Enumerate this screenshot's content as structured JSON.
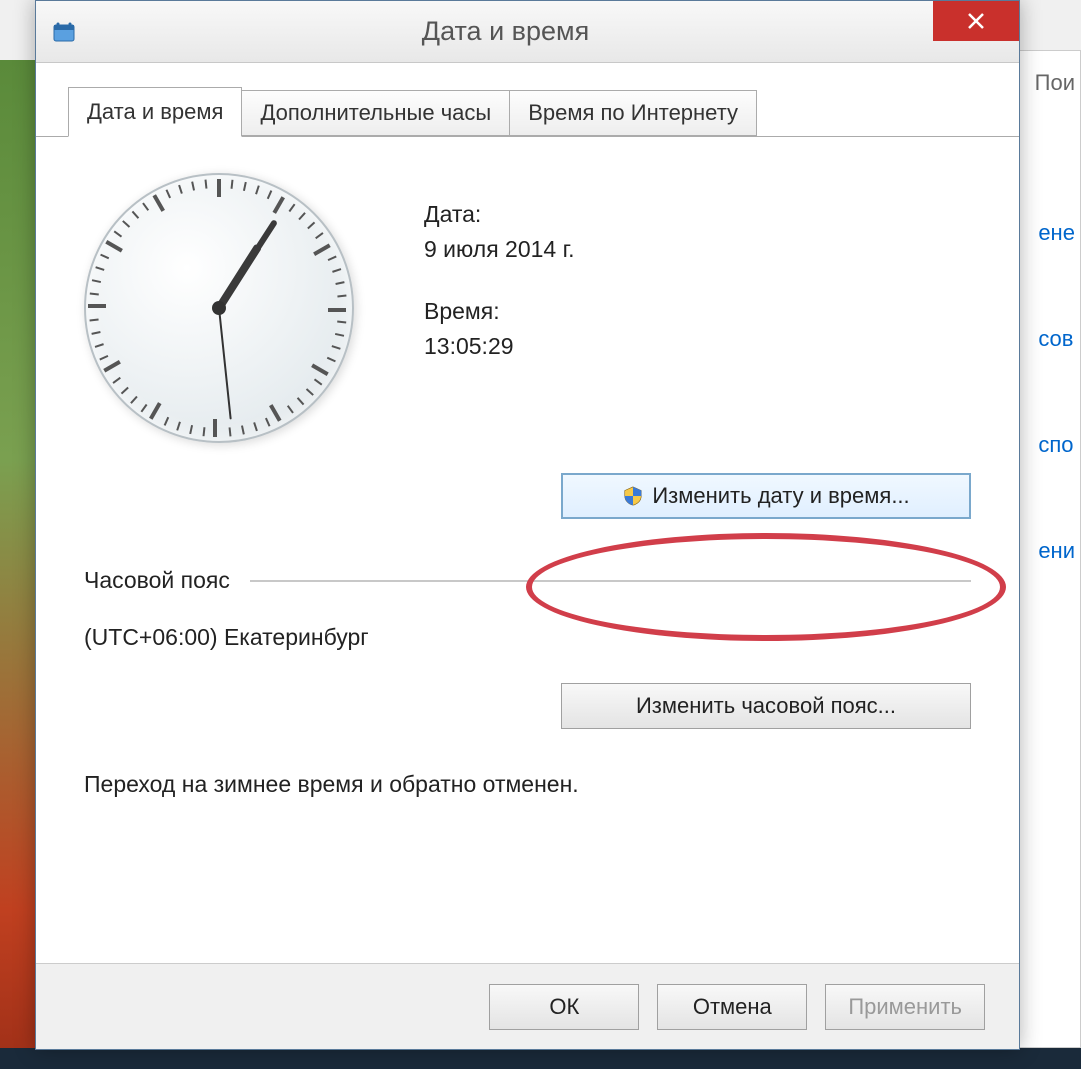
{
  "background": {
    "search_fragment": "Пои",
    "link1_fragment": "ене",
    "link2_fragment": "сов",
    "link3_fragment": "спо",
    "link4_fragment": "ени"
  },
  "dialog": {
    "title": "Дата и время",
    "tabs": [
      {
        "label": "Дата и время",
        "active": true
      },
      {
        "label": "Дополнительные часы",
        "active": false
      },
      {
        "label": "Время по Интернету",
        "active": false
      }
    ],
    "date_label": "Дата:",
    "date_value": "9 июля 2014 г.",
    "time_label": "Время:",
    "time_value": "13:05:29",
    "change_datetime_btn": "Изменить дату и время...",
    "timezone_header": "Часовой пояс",
    "timezone_value": "(UTC+06:00) Екатеринбург",
    "change_timezone_btn": "Изменить часовой пояс...",
    "dst_note": "Переход на зимнее время и обратно отменен.",
    "footer": {
      "ok": "ОК",
      "cancel": "Отмена",
      "apply": "Применить"
    },
    "clock": {
      "hours": 13,
      "minutes": 5,
      "seconds": 29
    }
  }
}
